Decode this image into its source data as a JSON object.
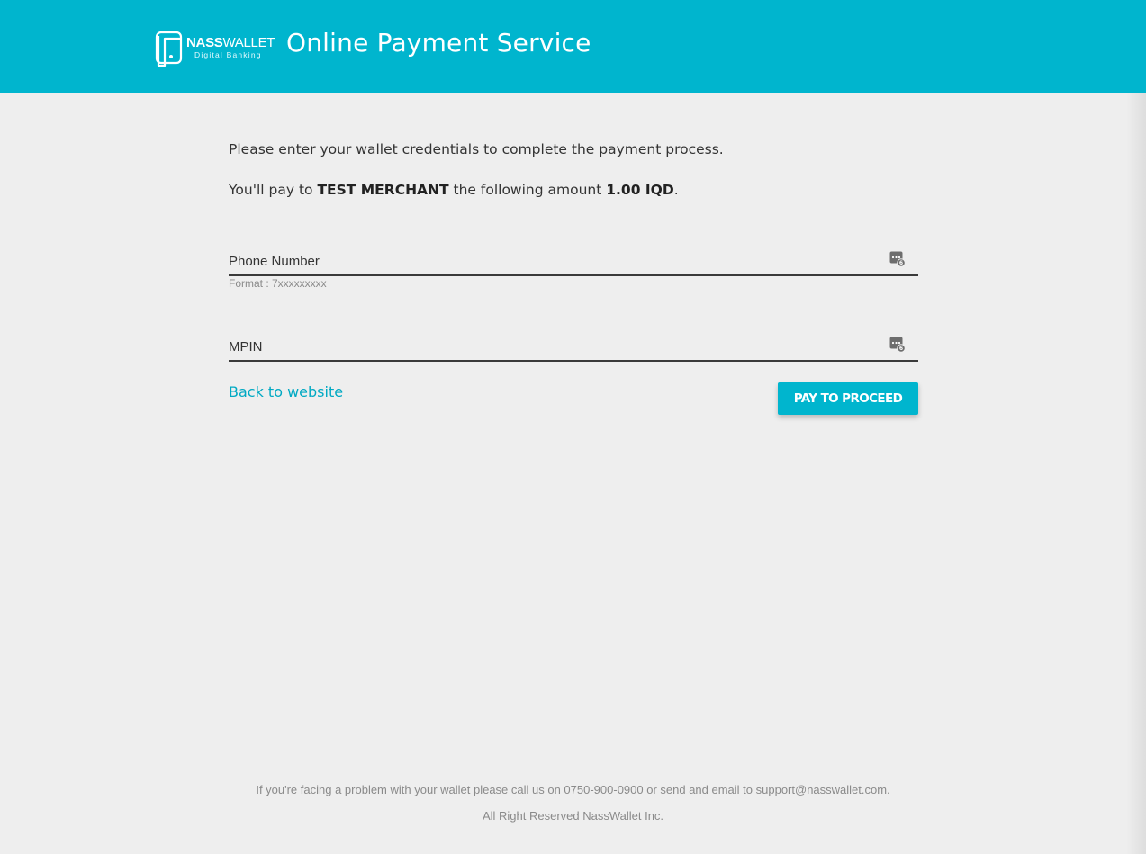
{
  "header": {
    "logo_brand_bold": "NASS",
    "logo_brand_light": "WALLET",
    "logo_tagline": "Digital Banking",
    "title": "Online Payment Service"
  },
  "main": {
    "intro": "Please enter your wallet credentials to complete the payment process.",
    "pay_prefix": "You'll pay to ",
    "merchant": "TEST MERCHANT",
    "pay_middle": " the following amount ",
    "amount": "1.00 IQD",
    "pay_suffix": "."
  },
  "form": {
    "phone": {
      "placeholder": "Phone Number",
      "value": "",
      "icon": "keypad-icon"
    },
    "phone_hint": "Format : 7xxxxxxxxx",
    "mpin": {
      "placeholder": "MPIN",
      "value": "",
      "icon": "keypad-icon"
    },
    "back_label": "Back to website",
    "pay_label": "PAY TO PROCEED"
  },
  "footer": {
    "help_text": "If you're facing a problem with your wallet please call us on 0750-900-0900 or send and email to support@nasswallet.com.",
    "copyright": "All Right Reserved NassWallet Inc."
  },
  "colors": {
    "brand": "#00b5ce",
    "link": "#00a9c3",
    "background": "#eeeeee"
  }
}
